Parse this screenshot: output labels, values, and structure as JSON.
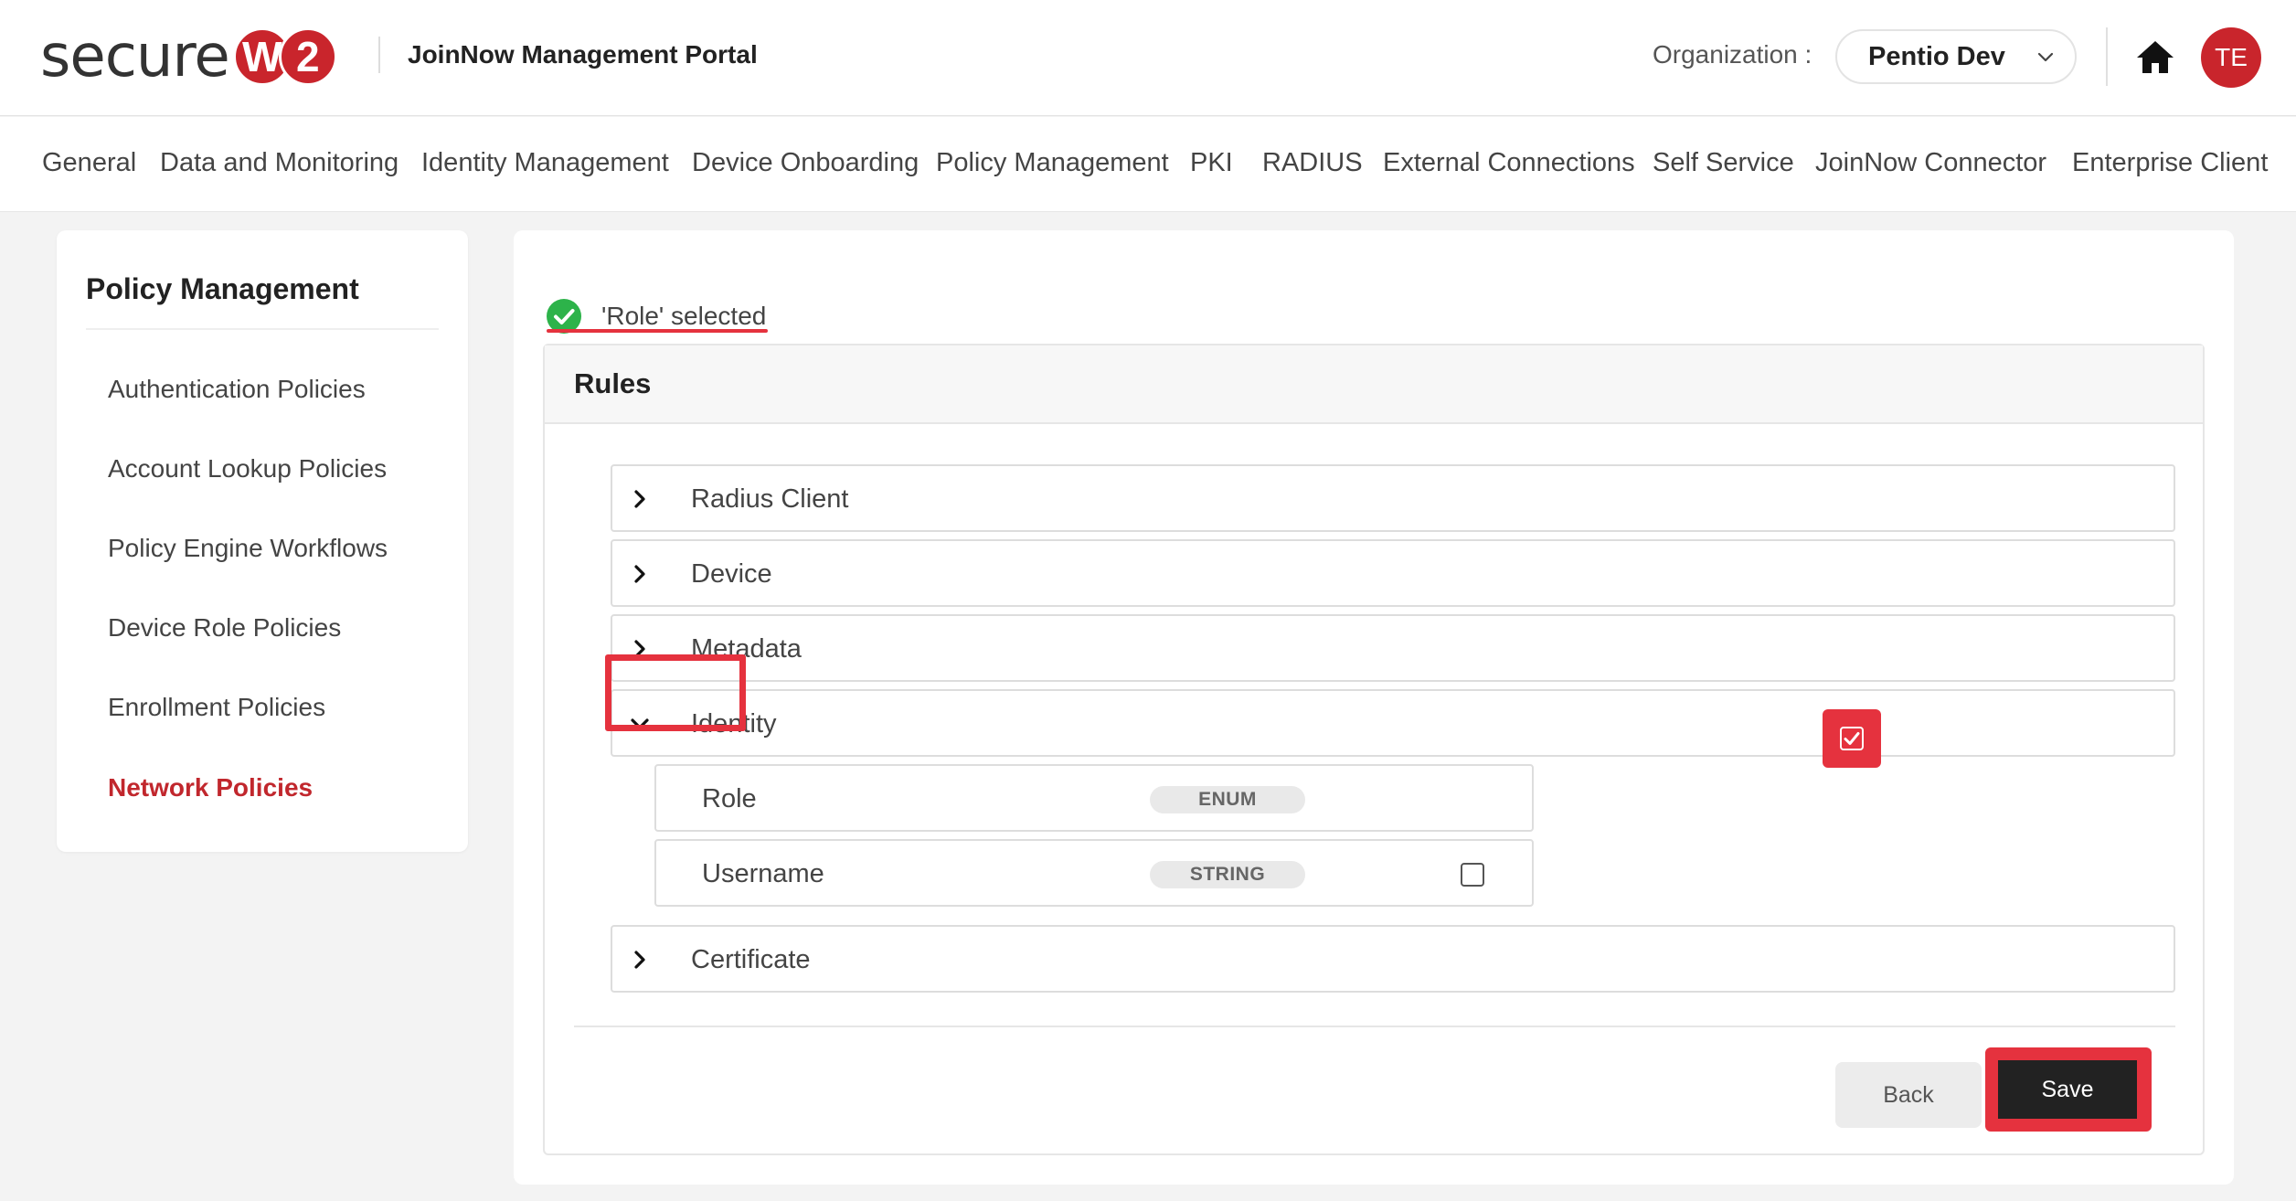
{
  "header": {
    "logo_text": "secure",
    "logo_w": "W",
    "logo_2": "2",
    "portal_title": "JoinNow Management Portal",
    "org_label": "Organization :",
    "org_value": "Pentio Dev",
    "avatar_initials": "TE",
    "brand_color": "#c9252c"
  },
  "nav": {
    "items": [
      "General",
      "Data and Monitoring",
      "Identity Management",
      "Device Onboarding",
      "Policy Management",
      "PKI",
      "RADIUS",
      "External Connections",
      "Self Service",
      "JoinNow Connector",
      "Enterprise Client"
    ]
  },
  "sidebar": {
    "title": "Policy Management",
    "items": [
      "Authentication Policies",
      "Account Lookup Policies",
      "Policy Engine Workflows",
      "Device Role Policies",
      "Enrollment Policies",
      "Network Policies"
    ],
    "active_index": 5
  },
  "main": {
    "selected_message": "'Role' selected",
    "rules_title": "Rules",
    "groups": [
      {
        "label": "Radius Client",
        "expanded": false
      },
      {
        "label": "Device",
        "expanded": false
      },
      {
        "label": "Metadata",
        "expanded": false
      },
      {
        "label": "Identity",
        "expanded": true
      },
      {
        "label": "Certificate",
        "expanded": false
      }
    ],
    "identity_fields": [
      {
        "label": "Role",
        "type": "ENUM",
        "checked": true
      },
      {
        "label": "Username",
        "type": "STRING",
        "checked": false
      }
    ],
    "back_label": "Back",
    "save_label": "Save",
    "highlight_color": "#e5323e",
    "success_color": "#2db34a"
  }
}
